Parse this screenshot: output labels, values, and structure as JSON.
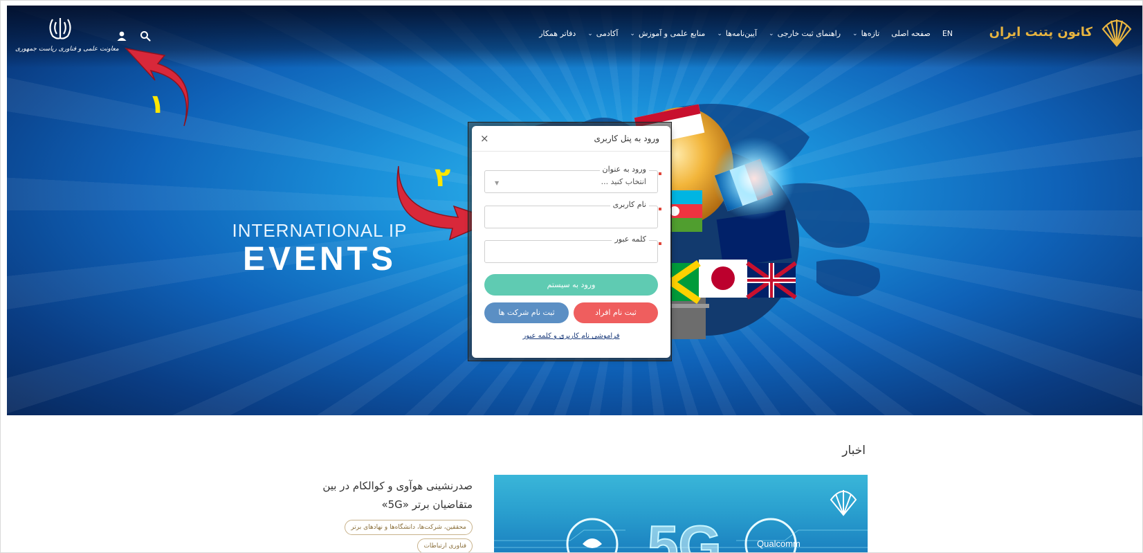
{
  "brand": {
    "name": "کانون پتنت ایران"
  },
  "nav": {
    "items": [
      {
        "label": "EN",
        "has_dropdown": false
      },
      {
        "label": "صفحه اصلی",
        "has_dropdown": false
      },
      {
        "label": "تازه‌ها",
        "has_dropdown": true
      },
      {
        "label": "راهنمای ثبت خارجی",
        "has_dropdown": true
      },
      {
        "label": "آیین‌نامه‌ها",
        "has_dropdown": true
      },
      {
        "label": "منابع علمی و آموزش",
        "has_dropdown": true
      },
      {
        "label": "آکادمی",
        "has_dropdown": true
      },
      {
        "label": "دفاتر همکار",
        "has_dropdown": false
      }
    ]
  },
  "header": {
    "emblem_caption": "معاونت علمی و فناوری ریاست جمهوری",
    "user_icon": "user-icon",
    "search_icon": "search-icon"
  },
  "hero": {
    "line1": "INTERNATIONAL IP",
    "line2": "EVENTS"
  },
  "annotations": {
    "arrow1_number": "۱",
    "arrow2_number": "۲"
  },
  "modal": {
    "title": "ورود به پنل کاربری",
    "close": "×",
    "role_label": "ورود به عنوان",
    "role_value": "انتخاب کنید ...",
    "username_label": "نام کاربری",
    "username_value": "",
    "password_label": "کلمه عبور",
    "password_value": "",
    "login_button": "ورود به سیستم",
    "register_person": "ثبت نام افراد",
    "register_company": "ثبت نام شرکت ها",
    "forgot_link": "فراموشی نام کاربری و کلمه عبور"
  },
  "news": {
    "section_title": "اخبار",
    "headline": "صدرنشینی هوآوی و کوالکام در بین متقاضیان برتر «5G»",
    "tags": [
      "محققین، شرکت‌ها، دانشگاه‌ها و نهادهای برتر",
      "فناوری ارتباطات"
    ],
    "image_text": "5G",
    "image_brand": "Qualcomm"
  },
  "colors": {
    "login": "#5fcbb2",
    "register_person": "#ef5e5e",
    "register_company": "#5b8fc4",
    "brand_gold": "#e7b440",
    "arrow_red": "#d8283a",
    "annotation_yellow": "#ffe600"
  }
}
